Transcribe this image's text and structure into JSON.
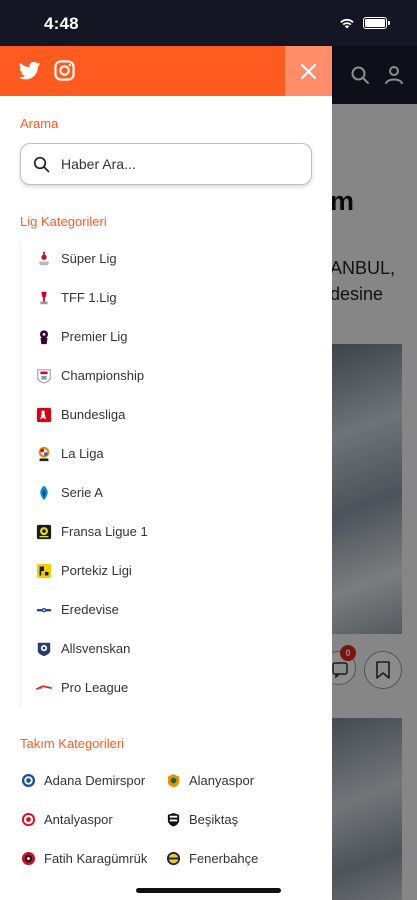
{
  "status_bar": {
    "time": "4:48"
  },
  "background": {
    "headline": "m",
    "text_line1": "ANBUL,",
    "text_line2": "desine",
    "comment_count": "0"
  },
  "drawer": {
    "search": {
      "title": "Arama",
      "placeholder": "Haber Ara..."
    },
    "leagues": {
      "title": "Lig Kategorileri",
      "items": [
        {
          "label": "Süper Lig",
          "icon": "super-lig-logo",
          "color": "#c8102e"
        },
        {
          "label": "TFF 1.Lig",
          "icon": "tff-1-lig-logo",
          "color": "#d1001f"
        },
        {
          "label": "Premier Lig",
          "icon": "premier-league-logo",
          "color": "#38003c"
        },
        {
          "label": "Championship",
          "icon": "championship-logo",
          "color": "#e4002b"
        },
        {
          "label": "Bundesliga",
          "icon": "bundesliga-logo",
          "color": "#d20515"
        },
        {
          "label": "La Liga",
          "icon": "la-liga-logo",
          "color": "#ee8707"
        },
        {
          "label": "Serie A",
          "icon": "serie-a-logo",
          "color": "#008fd7"
        },
        {
          "label": "Fransa Ligue 1",
          "icon": "ligue-1-logo",
          "color": "#dae025"
        },
        {
          "label": "Portekiz Ligi",
          "icon": "liga-portugal-logo",
          "color": "#f5d000"
        },
        {
          "label": "Eredevise",
          "icon": "eredivisie-logo",
          "color": "#1f3f8f"
        },
        {
          "label": "Allsvenskan",
          "icon": "allsvenskan-logo",
          "color": "#2a3c6b"
        },
        {
          "label": "Pro League",
          "icon": "pro-league-logo",
          "color": "#d62d2d"
        }
      ]
    },
    "teams": {
      "title": "Takım Kategorileri",
      "items": [
        {
          "label": "Adana Demirspor",
          "icon": "adana-demirspor-logo",
          "color": "#1c4fa0"
        },
        {
          "label": "Alanyaspor",
          "icon": "alanyaspor-logo",
          "color": "#f28c00"
        },
        {
          "label": "Antalyaspor",
          "icon": "antalyaspor-logo",
          "color": "#e30613"
        },
        {
          "label": "Beşiktaş",
          "icon": "besiktas-logo",
          "color": "#000000"
        },
        {
          "label": "Fatih Karagümrük",
          "icon": "fatih-karagumruk-logo",
          "color": "#c8102e"
        },
        {
          "label": "Fenerbahçe",
          "icon": "fenerbahce-logo",
          "color": "#13215f"
        }
      ]
    }
  },
  "colors": {
    "accent": "#ff5a1f",
    "close_bg": "#ff8d6a",
    "header_dark": "#1b1c2c"
  }
}
